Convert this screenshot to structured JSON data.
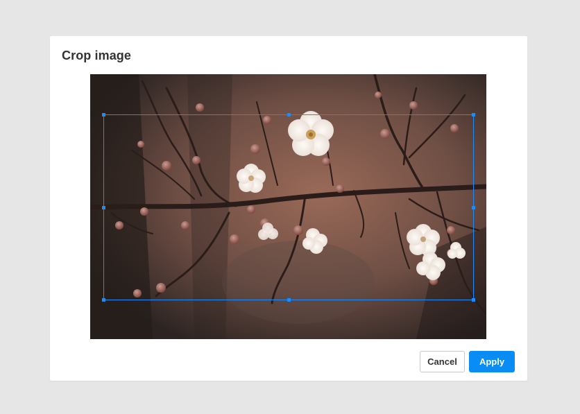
{
  "dialog": {
    "title": "Crop image"
  },
  "image": {
    "subject": "plum blossom branch photo",
    "crop_handles": [
      "top-left",
      "top-middle",
      "top-right",
      "middle-left",
      "middle-right",
      "bottom-left",
      "bottom-middle",
      "bottom-right"
    ]
  },
  "actions": {
    "cancel_label": "Cancel",
    "apply_label": "Apply"
  },
  "colors": {
    "accent": "#0a8cf5",
    "crop_border": "#1a8cff",
    "overlay_background": "#e6e6e6"
  }
}
